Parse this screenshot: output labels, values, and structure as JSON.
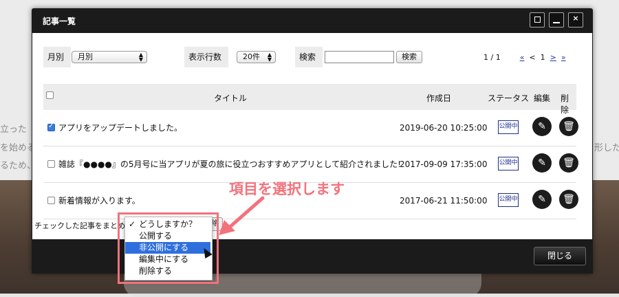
{
  "background": {
    "lines": [
      "立った",
      "を始める",
      "るため、",
      "形した"
    ]
  },
  "modal": {
    "title": "記事一覧",
    "buttons": {
      "maximize": "maximize-icon",
      "minimize": "minimize-icon",
      "close": "close-icon"
    },
    "close_label": "閉じる"
  },
  "filters": {
    "month_label": "月別",
    "month_value": "月別",
    "rows_label": "表示行数",
    "rows_value": "20件",
    "search_label": "検索",
    "search_value": "",
    "search_button": "検索"
  },
  "pagination": {
    "summary": "1 / 1",
    "first": "«",
    "prev": "<",
    "current": "1",
    "next": ">",
    "last": "»"
  },
  "table": {
    "headers": {
      "title": "タイトル",
      "created": "作成日",
      "status": "ステータス",
      "edit": "編集",
      "delete": "削除"
    },
    "rows": [
      {
        "checked": true,
        "title": "アプリをアップデートしました。",
        "date": "2019-06-20 10:25:00",
        "status": "公開中"
      },
      {
        "checked": false,
        "title": "雑誌『●●●●』の5月号に当アプリが夏の旅に役立つおすすめアプリとして紹介されました!",
        "date": "2017-09-09 17:35:00",
        "status": "公開中"
      },
      {
        "checked": false,
        "title": "新着情報が入ります。",
        "date": "2017-06-21 11:50:00",
        "status": "公開中"
      }
    ]
  },
  "bulk": {
    "label": "チェックした記事をまとめて",
    "button": "削除",
    "options": [
      "どうしますか？",
      "公開する",
      "非公開にする",
      "編集中にする",
      "削除する"
    ],
    "checked_index": 0,
    "highlighted_index": 2
  },
  "annotation": {
    "text": "項目を選択します",
    "color": "#f2727c"
  },
  "icons": {
    "edit": "pencil-icon",
    "delete": "trash-icon"
  }
}
